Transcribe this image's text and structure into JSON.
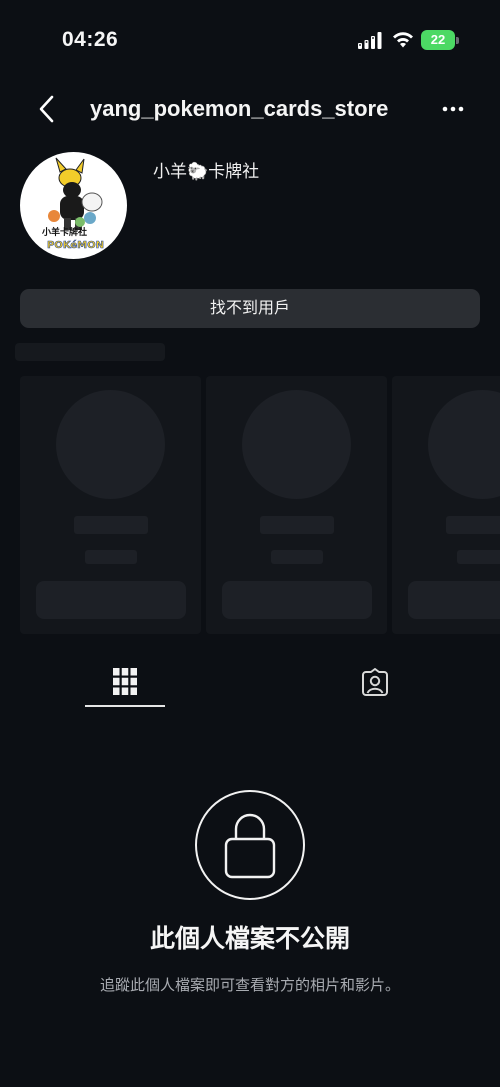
{
  "status_bar": {
    "time": "04:26",
    "battery": "22"
  },
  "header": {
    "username": "yang_pokemon_cards_store"
  },
  "profile": {
    "display_name": "小羊🐑卡牌社",
    "avatar_text": "小羊卡牌社",
    "avatar_logo": "POKéMON"
  },
  "action_button": {
    "label": "找不到用戶"
  },
  "private": {
    "title": "此個人檔案不公開",
    "subtitle": "追蹤此個人檔案即可查看對方的相片和影片。"
  },
  "colors": {
    "background": "#0c0f14",
    "button": "#2b2e33",
    "battery": "#4cd964",
    "muted_text": "#a8abb1"
  }
}
